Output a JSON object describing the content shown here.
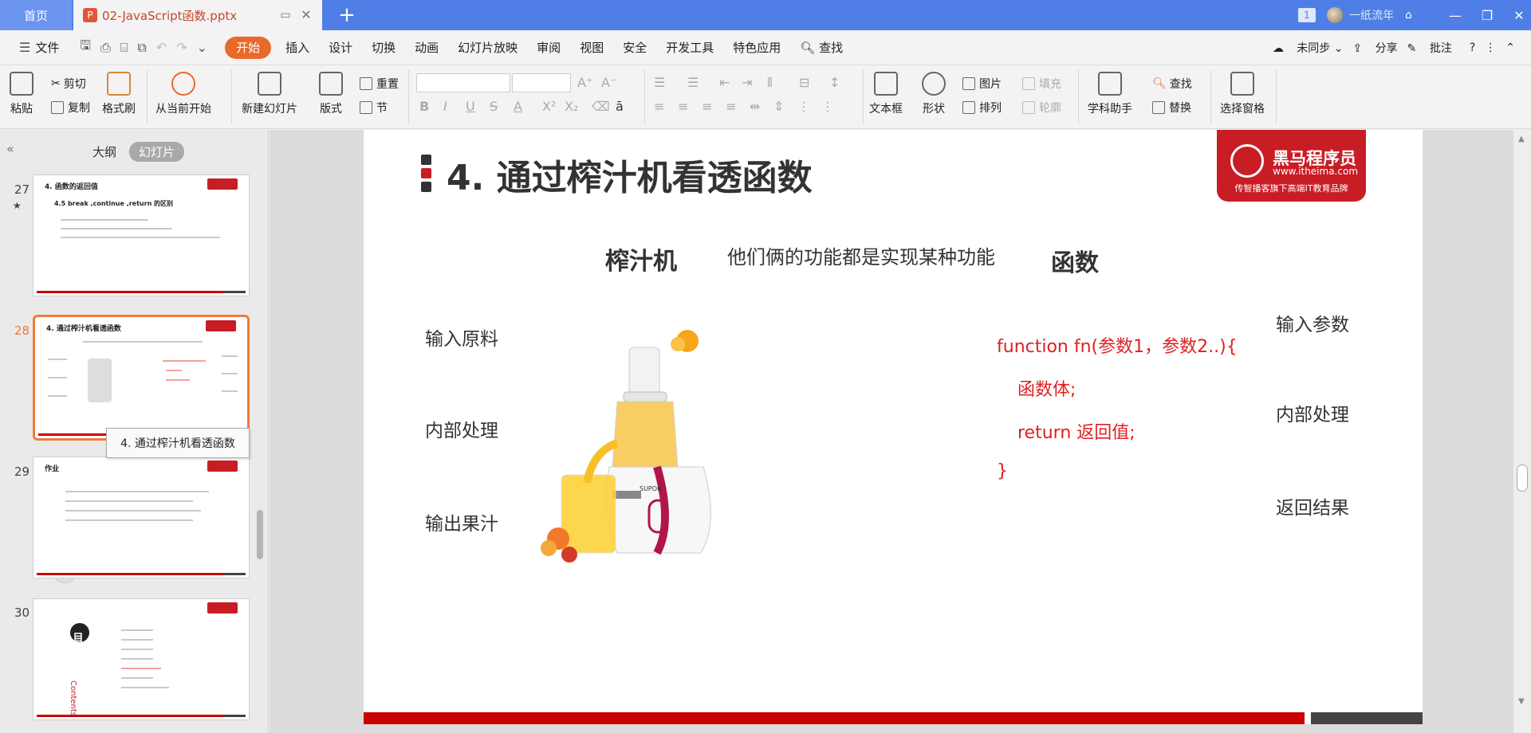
{
  "titlebar": {
    "home_tab": "首页",
    "doc_tab": "02-JavaScript函数.pptx",
    "new_tab": "+",
    "badge": "1",
    "user_name": "一纸流年"
  },
  "menubar": {
    "file": "文件",
    "tabs": [
      "开始",
      "插入",
      "设计",
      "切换",
      "动画",
      "幻灯片放映",
      "审阅",
      "视图",
      "安全",
      "开发工具",
      "特色应用"
    ],
    "search": "查找",
    "sync": "未同步",
    "share": "分享",
    "comment": "批注"
  },
  "ribbon": {
    "paste": "粘贴",
    "cut": "剪切",
    "copy": "复制",
    "format_painter": "格式刷",
    "from_current": "从当前开始",
    "new_slide": "新建幻灯片",
    "layout": "版式",
    "reset": "重置",
    "section": "节",
    "text_box": "文本框",
    "shape": "形状",
    "picture": "图片",
    "fill": "填充",
    "arrange": "排列",
    "outline": "轮廓",
    "subject_helper": "学科助手",
    "find": "查找",
    "replace": "替换",
    "select_pane": "选择窗格"
  },
  "sidepanel": {
    "tab_outline": "大纲",
    "tab_slides": "幻灯片",
    "thumbs": [
      {
        "num": "27",
        "title": "4. 函数的返回值",
        "subtitle": "4.5 break ,continue ,return 的区别"
      },
      {
        "num": "28",
        "title": "4. 通过榨汁机看透函数"
      },
      {
        "num": "29",
        "title": "作业"
      },
      {
        "num": "30",
        "title": "目录",
        "vertical": "Contents"
      }
    ],
    "tooltip": "4. 通过榨汁机看透函数"
  },
  "slide": {
    "title": "4. 通过榨汁机看透函数",
    "brand_name": "黑马程序员",
    "brand_url": "www.itheima.com",
    "brand_slogan": "传智播客旗下高端IT教育品牌",
    "juicer_label": "榨汁机",
    "middle_text": "他们俩的功能都是实现某种功能",
    "function_label": "函数",
    "left_labels": [
      "输入原料",
      "内部处理",
      "输出果汁"
    ],
    "right_labels": [
      "输入参数",
      "内部处理",
      "返回结果"
    ],
    "code_lines": [
      "function fn(参数1，参数2..){",
      "函数体;",
      "return 返回值;",
      "}"
    ],
    "juicer_brand": "SUPOR"
  },
  "colors": {
    "titlebar": "#4f7fe6",
    "accent": "#e8692b",
    "brand_red": "#c81d25",
    "code_red": "#e02020"
  }
}
